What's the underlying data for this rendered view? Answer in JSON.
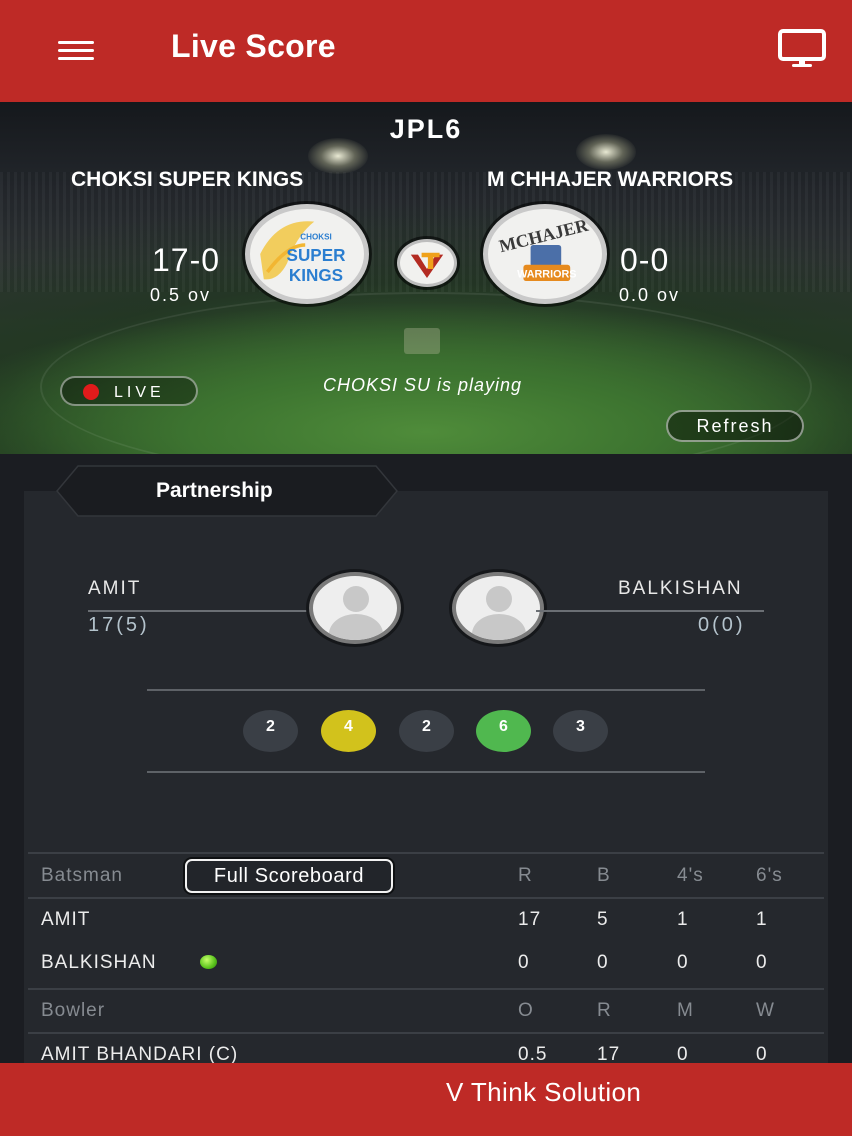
{
  "header": {
    "title": "Live Score",
    "menu_icon": "hamburger-menu-icon",
    "tv_icon": "monitor-icon"
  },
  "match": {
    "league": "JPL6",
    "team_a": {
      "name": "CHOKSI SUPER KINGS",
      "score": "17-0",
      "overs": "0.5 ov",
      "logo_text": [
        "CHOKSI",
        "SUPER",
        "KINGS"
      ],
      "logo_color": "#2b7ed0"
    },
    "team_b": {
      "name": "M CHHAJER WARRIORS",
      "score": "0-0",
      "overs": "0.0 ov",
      "logo_text": [
        "MCHAJER",
        "WARRIORS"
      ]
    },
    "live_label": "LIVE",
    "status": "CHOKSI SU is playing",
    "refresh_label": "Refresh"
  },
  "partnership": {
    "tab_label": "Partnership",
    "left": {
      "name": "AMIT",
      "runs": "17(5)"
    },
    "right": {
      "name": "BALKISHAN",
      "runs": "0(0)"
    },
    "balls": [
      "2",
      "4",
      "2",
      "6",
      "3"
    ]
  },
  "batting": {
    "header": {
      "label": "Batsman",
      "button": "Full Scoreboard",
      "r": "R",
      "b": "B",
      "fours": "4's",
      "sixes": "6's"
    },
    "rows": [
      {
        "name": "AMIT",
        "r": "17",
        "b": "5",
        "fours": "1",
        "sixes": "1"
      },
      {
        "name": "BALKISHAN",
        "r": "0",
        "b": "0",
        "fours": "0",
        "sixes": "0"
      }
    ]
  },
  "bowling": {
    "header": {
      "label": "Bowler",
      "o": "O",
      "r": "R",
      "m": "M",
      "w": "W"
    },
    "rows": [
      {
        "name": "AMIT BHANDARI (C)",
        "o": "0.5",
        "r": "17",
        "m": "0",
        "w": "0"
      }
    ]
  },
  "footer": {
    "text": "V Think Solution"
  },
  "colors": {
    "brand_red": "#be2a26",
    "panel": "#25282d",
    "four": "#d2c21c",
    "six": "#50b84f",
    "live_dot": "#e11b1b"
  }
}
